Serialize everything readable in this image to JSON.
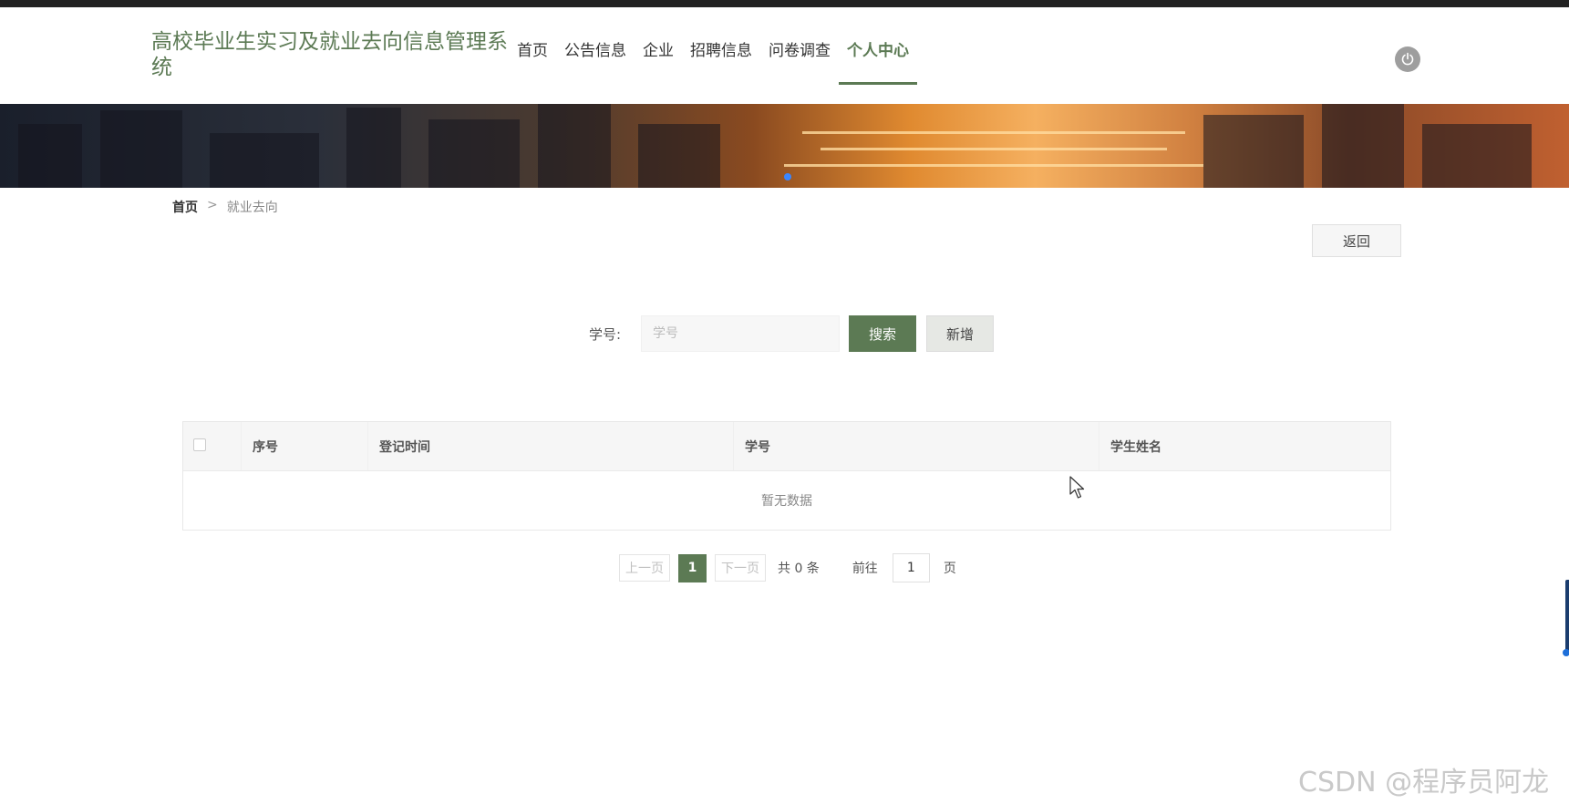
{
  "header": {
    "site_title": "高校毕业生实习及就业去向信息管理系统",
    "nav": [
      {
        "label": "首页"
      },
      {
        "label": "公告信息"
      },
      {
        "label": "企业"
      },
      {
        "label": "招聘信息"
      },
      {
        "label": "问卷调查"
      },
      {
        "label": "个人中心",
        "active": true
      }
    ],
    "power_icon": "power-icon"
  },
  "breadcrumb": {
    "home": "首页",
    "separator": ">",
    "current": "就业去向"
  },
  "actions": {
    "back_label": "返回"
  },
  "search": {
    "label": "学号:",
    "placeholder": "学号",
    "value": "",
    "search_label": "搜索",
    "add_label": "新增"
  },
  "table": {
    "columns": [
      "序号",
      "登记时间",
      "学号",
      "学生姓名"
    ],
    "rows": [],
    "empty_text": "暂无数据"
  },
  "pagination": {
    "prev_label": "上一页",
    "current_page": "1",
    "next_label": "下一页",
    "total_text": "共 0 条",
    "goto_label": "前往",
    "goto_value": "1",
    "page_suffix": "页"
  },
  "watermark": "CSDN @程序员阿龙",
  "colors": {
    "accent": "#5c7a54",
    "topbar": "#222222"
  }
}
